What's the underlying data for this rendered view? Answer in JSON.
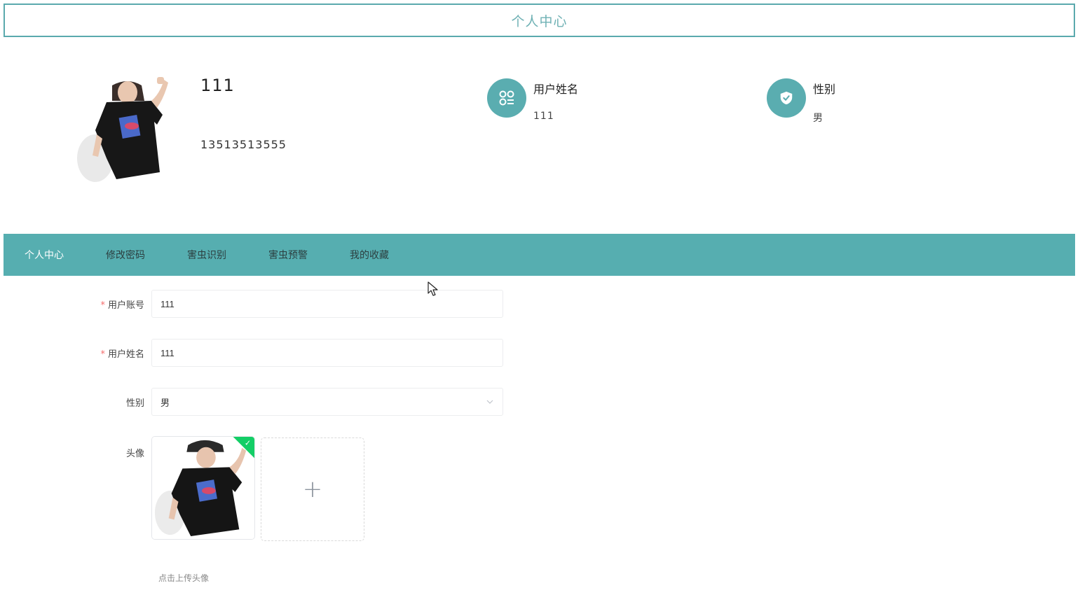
{
  "header": {
    "title": "个人中心"
  },
  "profile": {
    "name": "111",
    "phone": "13513513555",
    "username_label": "用户姓名",
    "username_value": "111",
    "gender_label": "性别",
    "gender_value": "男"
  },
  "nav": {
    "items": [
      {
        "label": "个人中心"
      },
      {
        "label": "修改密码"
      },
      {
        "label": "害虫识别"
      },
      {
        "label": "害虫预警"
      },
      {
        "label": "我的收藏"
      }
    ]
  },
  "form": {
    "account_label": "用户账号",
    "account_value": "111",
    "name_label": "用户姓名",
    "name_value": "111",
    "gender_label": "性别",
    "gender_value": "男",
    "avatar_label": "头像",
    "required_mark": "*",
    "upload_plus": "+",
    "upload_tip": "点击上传头像"
  },
  "colors": {
    "accent": "#56aeb0",
    "required": "#f56c6c",
    "success": "#13ce66"
  },
  "icons": {
    "username": "apps-icon",
    "gender": "shield-check-icon",
    "select": "chevron-down-icon",
    "upload_success": "check-icon"
  }
}
